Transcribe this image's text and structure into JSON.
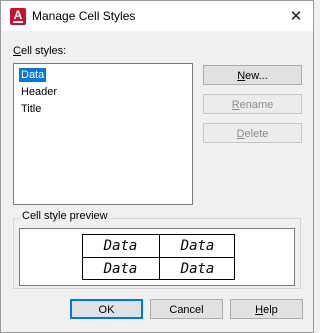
{
  "window": {
    "title": "Manage Cell Styles",
    "close_glyph": "✕",
    "app_icon_letter": "A"
  },
  "cell_styles": {
    "label_prefix": "C",
    "label_rest": "ell styles:",
    "items": [
      {
        "label": "Data",
        "selected": true
      },
      {
        "label": "Header",
        "selected": false
      },
      {
        "label": "Title",
        "selected": false
      }
    ]
  },
  "side_buttons": {
    "new": {
      "u": "N",
      "rest": "ew...",
      "enabled": true
    },
    "rename": {
      "u": "R",
      "rest": "ename",
      "enabled": false
    },
    "delete": {
      "u": "D",
      "rest": "elete",
      "enabled": false
    }
  },
  "preview": {
    "group_label": "Cell style preview",
    "cells": [
      "Data",
      "Data",
      "Data",
      "Data"
    ]
  },
  "footer": {
    "ok_label": "OK",
    "cancel_label": "Cancel",
    "help_u": "H",
    "help_rest": "elp"
  },
  "colors": {
    "selection": "#0078d7",
    "app_icon": "#c8102e"
  }
}
